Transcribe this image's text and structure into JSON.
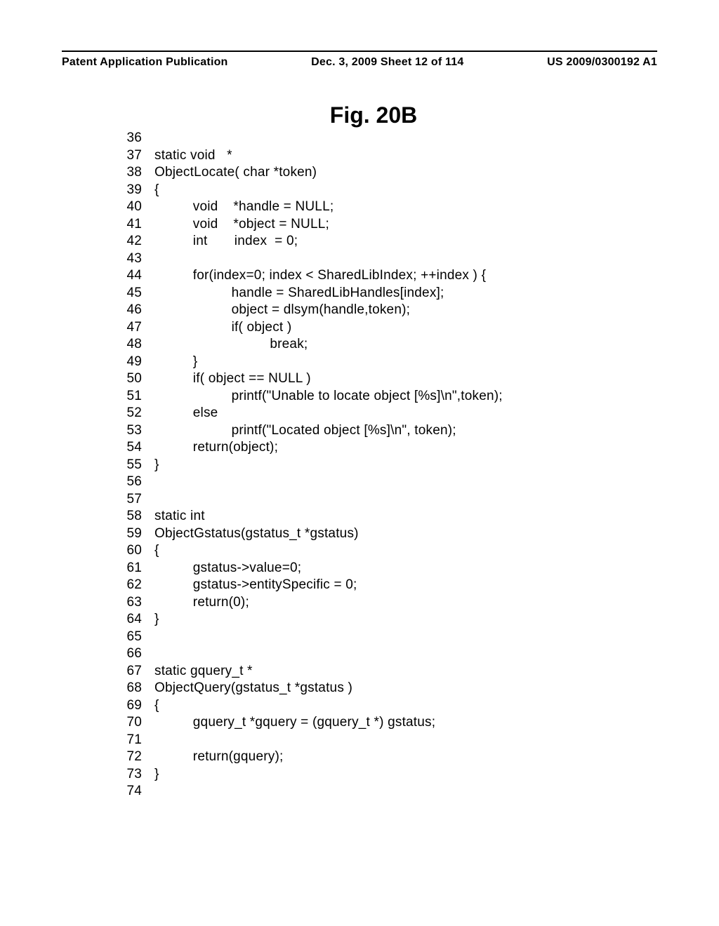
{
  "header": {
    "left": "Patent Application Publication",
    "center": "Dec. 3, 2009  Sheet 12 of 114",
    "right": "US 2009/0300192 A1"
  },
  "figure_title": "Fig. 20B",
  "code_lines": [
    {
      "n": "36",
      "t": ""
    },
    {
      "n": "37",
      "t": "static void   *"
    },
    {
      "n": "38",
      "t": "ObjectLocate( char *token)"
    },
    {
      "n": "39",
      "t": "{"
    },
    {
      "n": "40",
      "t": "          void    *handle = NULL;"
    },
    {
      "n": "41",
      "t": "          void    *object = NULL;"
    },
    {
      "n": "42",
      "t": "          int       index  = 0;"
    },
    {
      "n": "43",
      "t": ""
    },
    {
      "n": "44",
      "t": "          for(index=0; index < SharedLibIndex; ++index ) {"
    },
    {
      "n": "45",
      "t": "                    handle = SharedLibHandles[index];"
    },
    {
      "n": "46",
      "t": "                    object = dlsym(handle,token);"
    },
    {
      "n": "47",
      "t": "                    if( object )"
    },
    {
      "n": "48",
      "t": "                              break;"
    },
    {
      "n": "49",
      "t": "          }"
    },
    {
      "n": "50",
      "t": "          if( object == NULL )"
    },
    {
      "n": "51",
      "t": "                    printf(\"Unable to locate object [%s]\\n\",token);"
    },
    {
      "n": "52",
      "t": "          else"
    },
    {
      "n": "53",
      "t": "                    printf(\"Located object [%s]\\n\", token);"
    },
    {
      "n": "54",
      "t": "          return(object);"
    },
    {
      "n": "55",
      "t": "}"
    },
    {
      "n": "56",
      "t": ""
    },
    {
      "n": "57",
      "t": ""
    },
    {
      "n": "58",
      "t": "static int"
    },
    {
      "n": "59",
      "t": "ObjectGstatus(gstatus_t *gstatus)"
    },
    {
      "n": "60",
      "t": "{"
    },
    {
      "n": "61",
      "t": "          gstatus->value=0;"
    },
    {
      "n": "62",
      "t": "          gstatus->entitySpecific = 0;"
    },
    {
      "n": "63",
      "t": "          return(0);"
    },
    {
      "n": "64",
      "t": "}"
    },
    {
      "n": "65",
      "t": ""
    },
    {
      "n": "66",
      "t": ""
    },
    {
      "n": "67",
      "t": "static gquery_t *"
    },
    {
      "n": "68",
      "t": "ObjectQuery(gstatus_t *gstatus )"
    },
    {
      "n": "69",
      "t": "{"
    },
    {
      "n": "70",
      "t": "          gquery_t *gquery = (gquery_t *) gstatus;"
    },
    {
      "n": "71",
      "t": ""
    },
    {
      "n": "72",
      "t": "          return(gquery);"
    },
    {
      "n": "73",
      "t": "}"
    },
    {
      "n": "74",
      "t": ""
    }
  ]
}
